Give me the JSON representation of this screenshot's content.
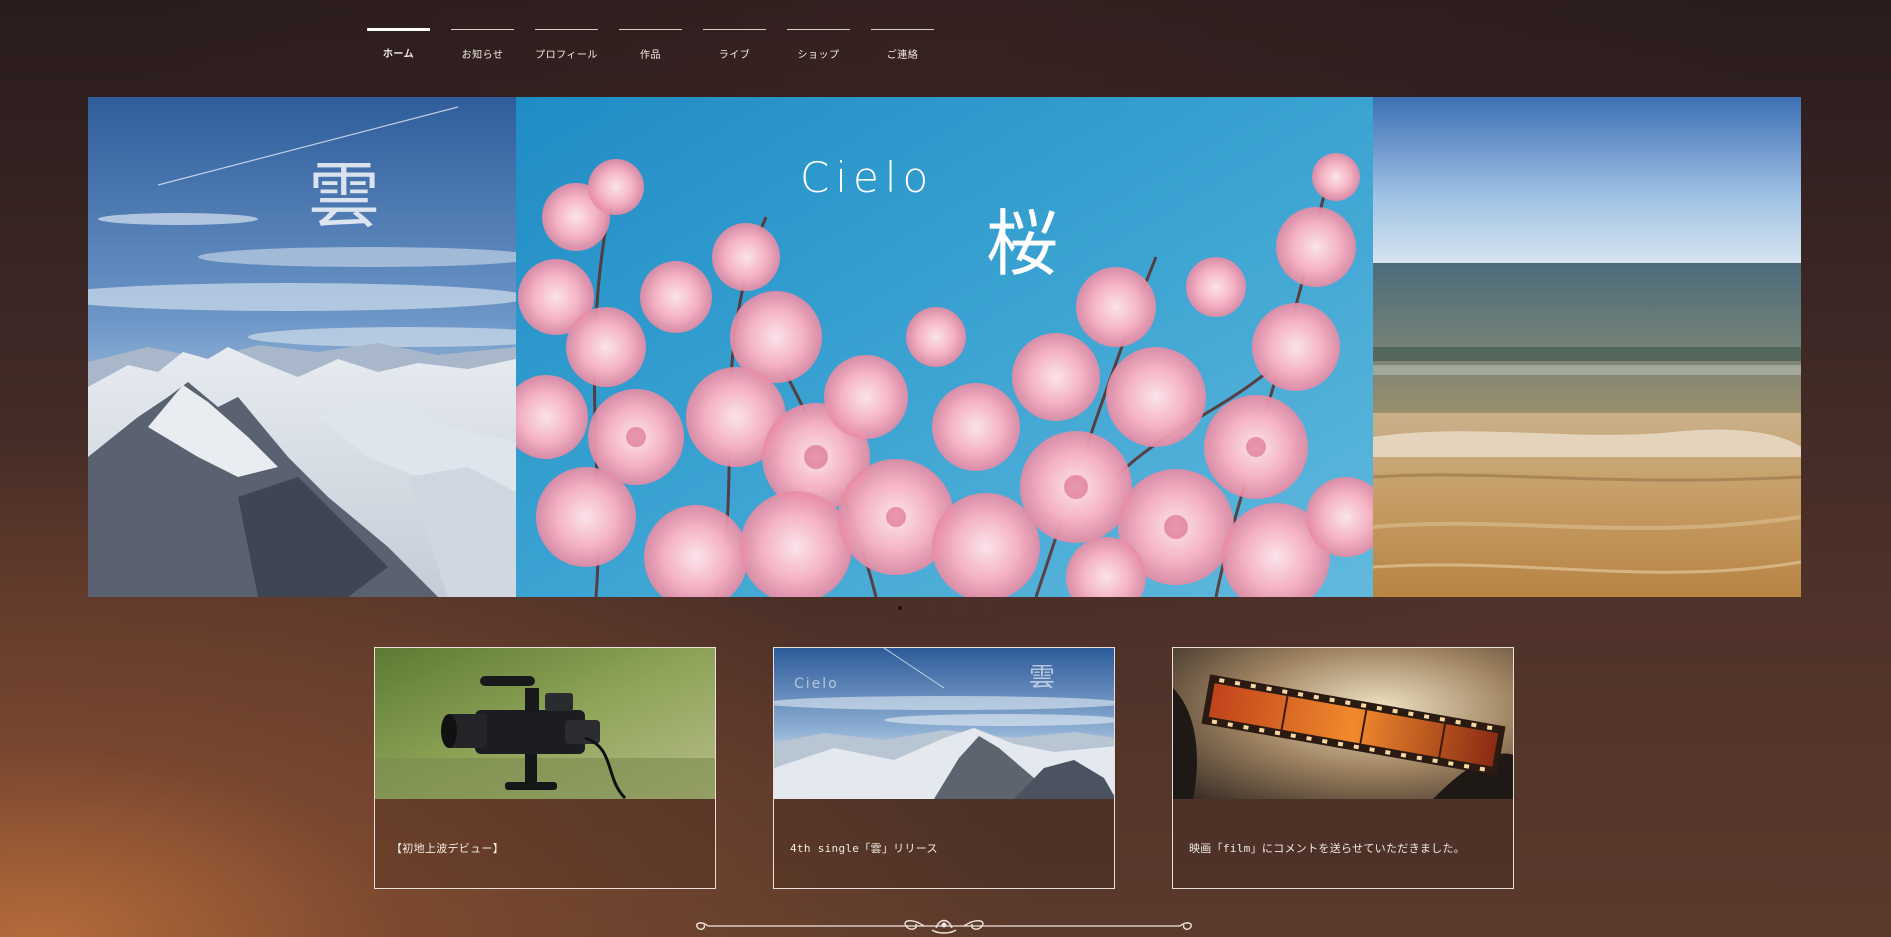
{
  "nav": {
    "items": [
      {
        "label": "ホーム",
        "active": true
      },
      {
        "label": "お知らせ"
      },
      {
        "label": "プロフィール"
      },
      {
        "label": "作品"
      },
      {
        "label": "ライブ"
      },
      {
        "label": "ショップ"
      },
      {
        "label": "ご連絡"
      }
    ]
  },
  "slider": {
    "slides": [
      {
        "title": "雲",
        "scene": "snowy-mountains-sky"
      },
      {
        "title_en": "Cielo",
        "title_jp": "桜",
        "scene": "cherry-blossoms-sky"
      },
      {
        "scene": "beach-sea-sand"
      }
    ],
    "dots": 4,
    "active_dot": 0
  },
  "cards": [
    {
      "text": "【初地上波デビュー】",
      "image": "video-camera"
    },
    {
      "text": "4th single「雲」リリース",
      "image": "mountains-cielo-kumo",
      "image_text_en": "Cielo",
      "image_text_jp": "雲"
    },
    {
      "text": "映画「film」にコメントを送らせていただきました。",
      "image": "film-strip"
    }
  ],
  "colors": {
    "background_dark": "#2a1c1d",
    "background_warm": "#5a3a2c",
    "accent_white": "#ffffff",
    "card_border": "#eadfd8"
  }
}
